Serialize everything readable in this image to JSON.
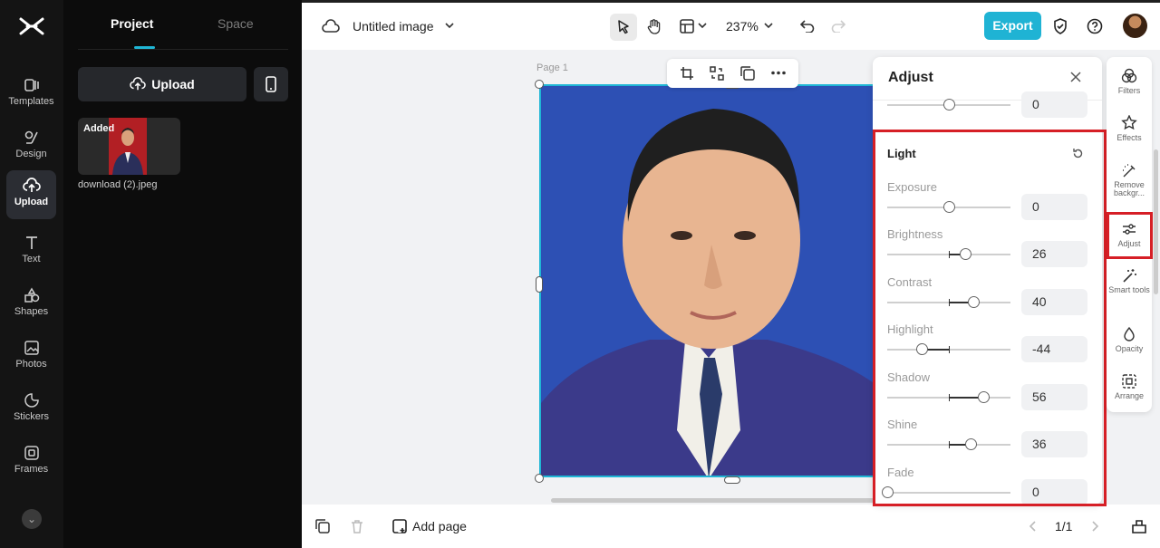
{
  "rail": {
    "items": [
      {
        "label": "Templates",
        "icon": "templates-icon"
      },
      {
        "label": "Design",
        "icon": "design-icon"
      },
      {
        "label": "Upload",
        "icon": "upload-cloud-icon",
        "active": true
      },
      {
        "label": "Text",
        "icon": "text-icon"
      },
      {
        "label": "Shapes",
        "icon": "shapes-icon"
      },
      {
        "label": "Photos",
        "icon": "photos-icon"
      },
      {
        "label": "Stickers",
        "icon": "stickers-icon"
      },
      {
        "label": "Frames",
        "icon": "frames-icon"
      }
    ]
  },
  "panel": {
    "tab_project": "Project",
    "tab_space": "Space",
    "upload_label": "Upload",
    "thumb_badge": "Added",
    "thumb_name": "download (2).jpeg"
  },
  "topbar": {
    "title": "Untitled image",
    "zoom": "237%",
    "export": "Export"
  },
  "canvas": {
    "page_label": "Page 1"
  },
  "bottombar": {
    "add_page": "Add page",
    "page_count": "1/1"
  },
  "adjust": {
    "title": "Adjust",
    "prev_value": "0",
    "section": "Light",
    "sliders": [
      {
        "label": "Exposure",
        "value": "0",
        "num": 0
      },
      {
        "label": "Brightness",
        "value": "26",
        "num": 26
      },
      {
        "label": "Contrast",
        "value": "40",
        "num": 40
      },
      {
        "label": "Highlight",
        "value": "-44",
        "num": -44
      },
      {
        "label": "Shadow",
        "value": "56",
        "num": 56
      },
      {
        "label": "Shine",
        "value": "36",
        "num": 36
      },
      {
        "label": "Fade",
        "value": "0",
        "num": 0
      }
    ]
  },
  "strip": {
    "items": [
      {
        "label": "Filters",
        "icon": "filters-icon"
      },
      {
        "label": "Effects",
        "icon": "effects-icon"
      },
      {
        "label": "Remove backgr...",
        "icon": "remove-background-icon"
      },
      {
        "label": "Adjust",
        "icon": "adjust-icon",
        "active": true
      },
      {
        "label": "Smart tools",
        "icon": "smart-tools-icon"
      },
      {
        "label": "Opacity",
        "icon": "opacity-icon"
      },
      {
        "label": "Arrange",
        "icon": "arrange-icon"
      }
    ]
  },
  "colors": {
    "accent": "#1fb3d4",
    "highlight_box": "#d61f26",
    "rail_bg": "#141414"
  }
}
